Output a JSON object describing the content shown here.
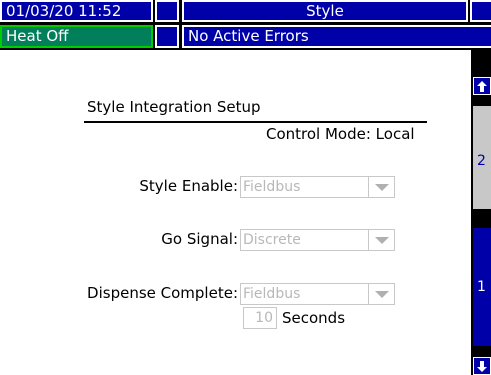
{
  "status_bar": {
    "datetime": "01/03/20 11:52",
    "screen_title": "Style",
    "heat_status": "Heat Off",
    "error_status": "No Active Errors"
  },
  "panel": {
    "heading": "Style Integration Setup",
    "control_mode": "Control Mode: Local",
    "fields": {
      "style_enable": {
        "label": "Style Enable:",
        "value": "Fieldbus"
      },
      "go_signal": {
        "label": "Go Signal:",
        "value": "Discrete"
      },
      "dispense_complete": {
        "label": "Dispense Complete:",
        "value": "Fieldbus"
      }
    },
    "timeout": {
      "value": "10",
      "unit": "Seconds"
    }
  },
  "nav": {
    "up_icon": "arrow-up-icon",
    "down_icon": "arrow-down-icon",
    "tabs": [
      "2",
      "1"
    ]
  },
  "colors": {
    "header_blue": "#0000a8",
    "heat_green": "#007f5a",
    "border_green": "#00cc00",
    "tab_gray": "#c8c8c8"
  }
}
